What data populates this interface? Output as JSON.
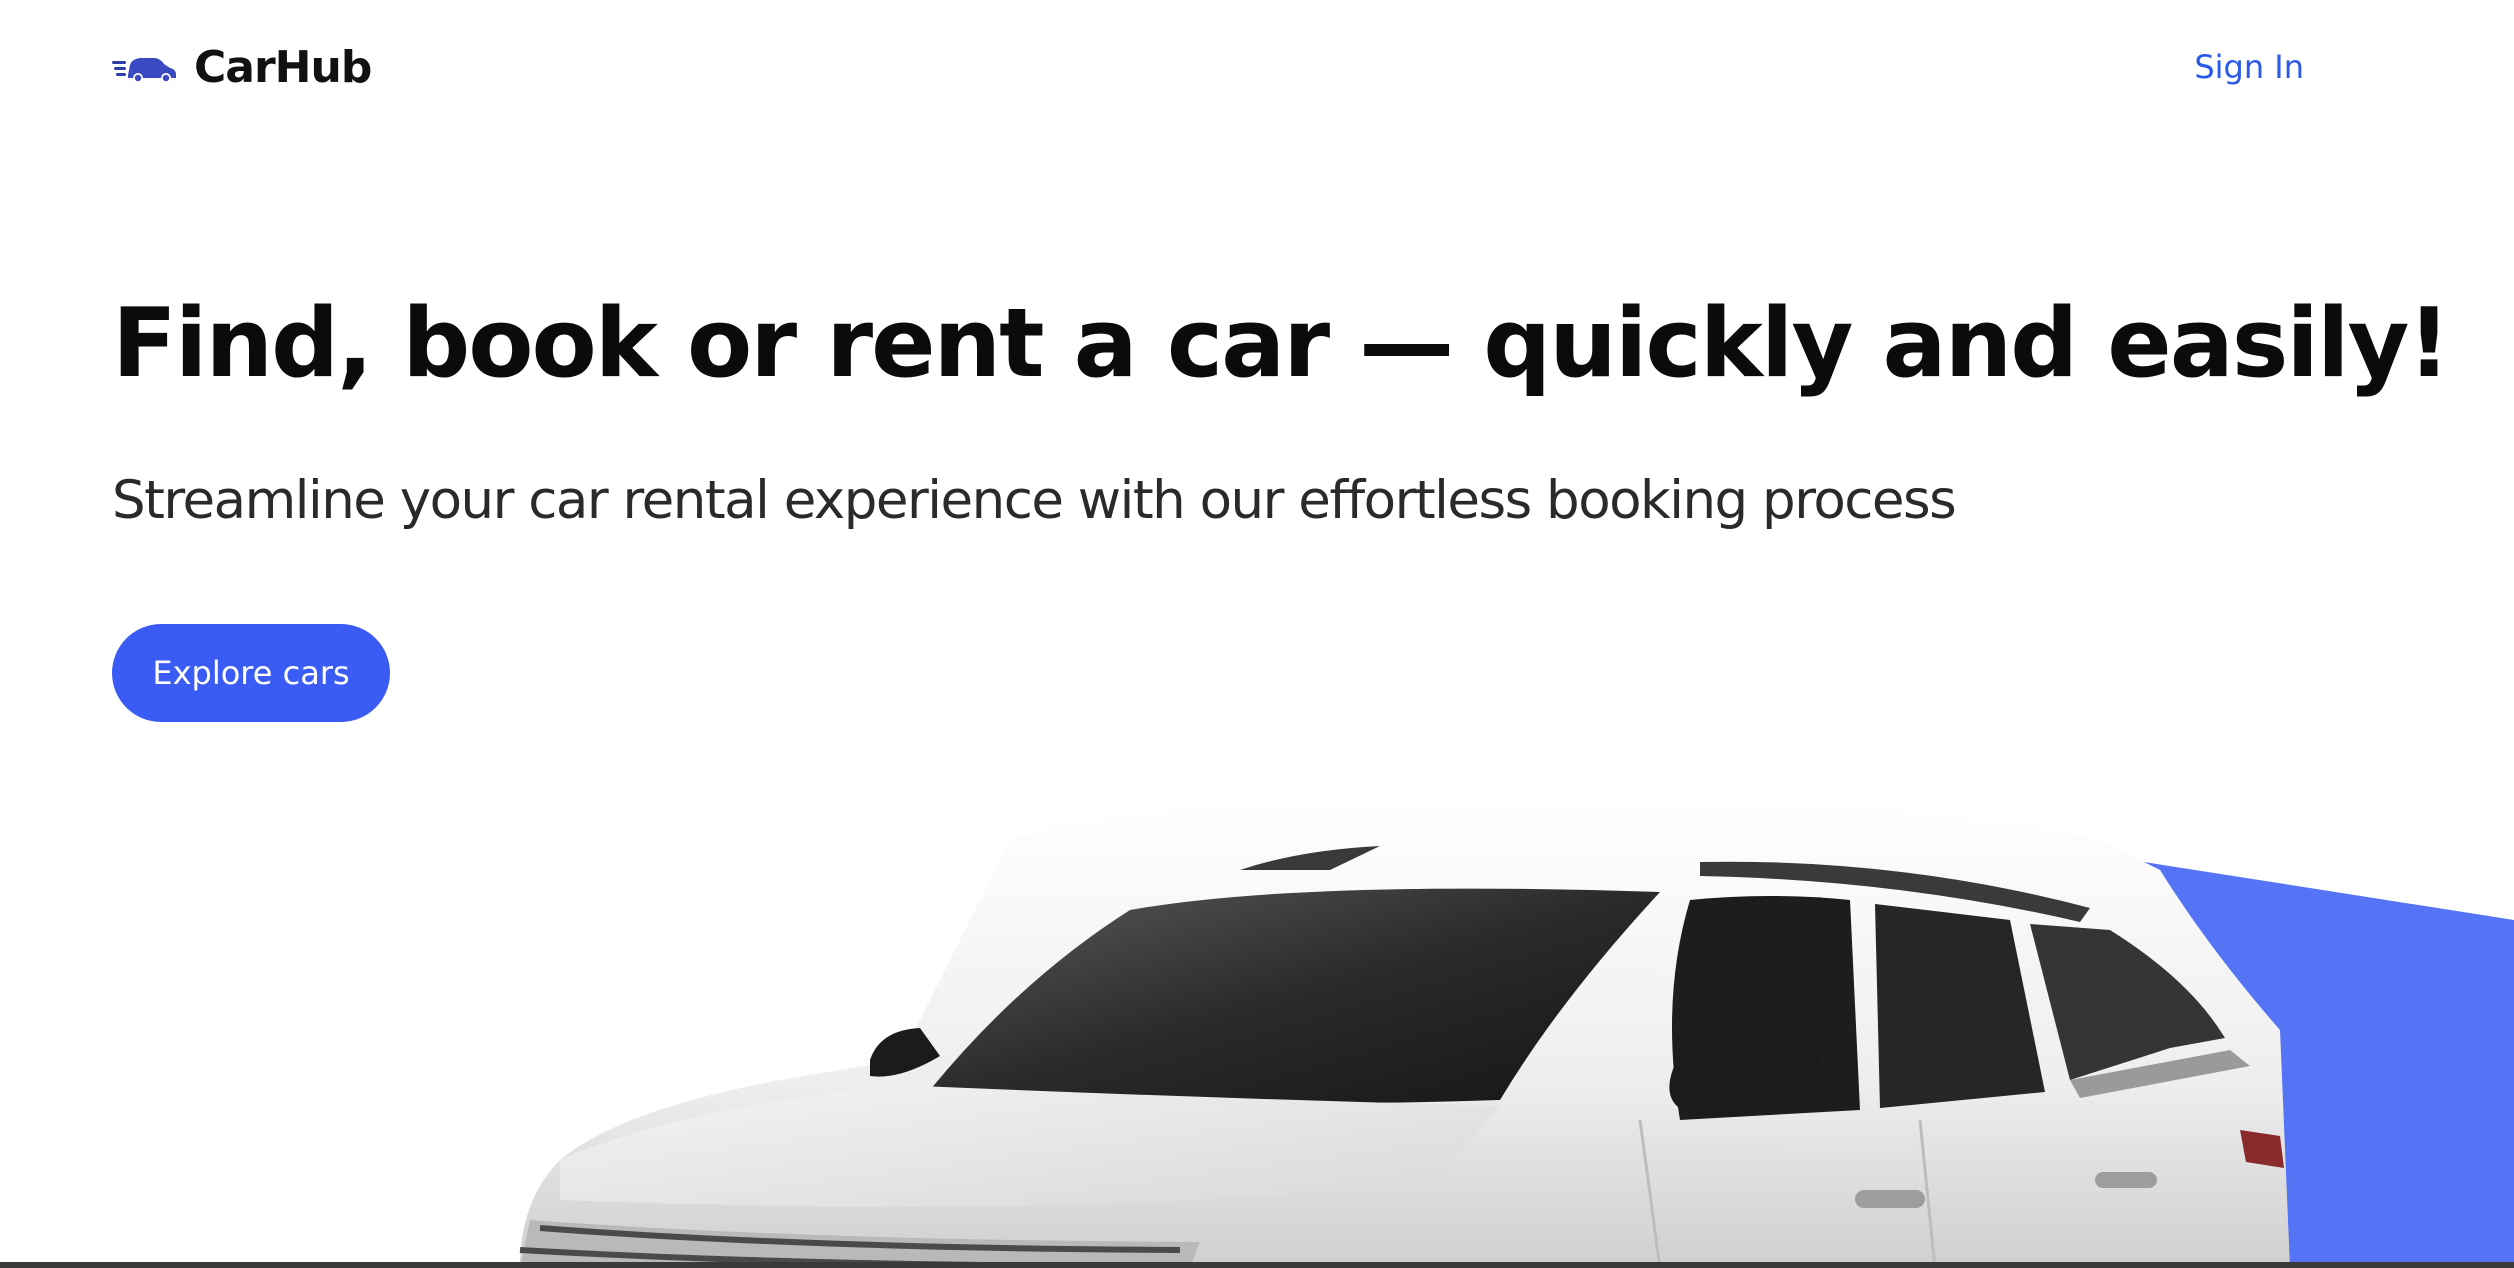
{
  "brand": {
    "name": "CarHub",
    "logo_icon": "car-speed-icon",
    "accent_color": "#3a5cf5"
  },
  "nav": {
    "signin_label": "Sign In"
  },
  "hero": {
    "title": "Find, book or rent a car — quickly and easily!",
    "subtitle": "Streamline your car rental experience with our effortless booking process",
    "cta_label": "Explore cars",
    "image_icon": "white-suv-image"
  }
}
